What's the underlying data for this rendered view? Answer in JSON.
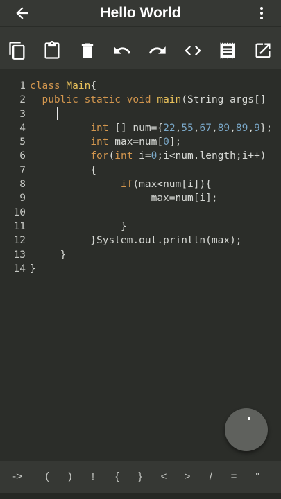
{
  "appbar": {
    "title": "Hello World",
    "back_icon": "arrow-back-icon",
    "menu_icon": "more-vert-icon"
  },
  "toolbar": {
    "tools": [
      "copy-icon",
      "paste-icon",
      "delete-icon",
      "undo-icon",
      "redo-icon",
      "code-icon",
      "receipt-icon",
      "open-external-icon"
    ]
  },
  "editor": {
    "line_numbers": [
      "1",
      "2",
      "3",
      "4",
      "5",
      "6",
      "7",
      "8",
      "9",
      "10",
      "11",
      "12",
      "13",
      "14"
    ],
    "lines": [
      [
        {
          "t": "class",
          "c": "kw"
        },
        {
          "t": " "
        },
        {
          "t": "Main",
          "c": "fn"
        },
        {
          "t": "{"
        }
      ],
      [
        {
          "t": "  "
        },
        {
          "t": "public static void",
          "c": "kw"
        },
        {
          "t": " "
        },
        {
          "t": "main",
          "c": "fn"
        },
        {
          "t": "(String args[]"
        }
      ],
      [],
      [
        {
          "t": "          "
        },
        {
          "t": "int",
          "c": "kw"
        },
        {
          "t": " [] num={"
        },
        {
          "t": "22",
          "c": "num"
        },
        {
          "t": ","
        },
        {
          "t": "55",
          "c": "num"
        },
        {
          "t": ","
        },
        {
          "t": "67",
          "c": "num"
        },
        {
          "t": ","
        },
        {
          "t": "89",
          "c": "num"
        },
        {
          "t": ","
        },
        {
          "t": "89",
          "c": "num"
        },
        {
          "t": ","
        },
        {
          "t": "9",
          "c": "num"
        },
        {
          "t": "};"
        }
      ],
      [
        {
          "t": "          "
        },
        {
          "t": "int",
          "c": "kw"
        },
        {
          "t": " max=num["
        },
        {
          "t": "0",
          "c": "num"
        },
        {
          "t": "];"
        }
      ],
      [
        {
          "t": "          "
        },
        {
          "t": "for",
          "c": "kw"
        },
        {
          "t": "("
        },
        {
          "t": "int",
          "c": "kw"
        },
        {
          "t": " i="
        },
        {
          "t": "0",
          "c": "num"
        },
        {
          "t": ";i<num.length;i++)"
        }
      ],
      [
        {
          "t": "          {"
        }
      ],
      [
        {
          "t": "               "
        },
        {
          "t": "if",
          "c": "kw"
        },
        {
          "t": "(max<num[i]){"
        }
      ],
      [
        {
          "t": "                    max=num[i];"
        }
      ],
      [],
      [
        {
          "t": "               }"
        }
      ],
      [
        {
          "t": "          }System.out.println(max);"
        }
      ],
      [
        {
          "t": "     }"
        }
      ],
      [
        {
          "t": "}"
        }
      ]
    ]
  },
  "symbols": [
    "->",
    "(",
    ")",
    "!",
    "{",
    "}",
    "<",
    ">",
    "/",
    "=",
    "\""
  ],
  "colors": {
    "background": "#2b2d29",
    "bar": "#363834",
    "keyword": "#d2964e",
    "number": "#7aa8c8",
    "method": "#e8c05a",
    "text": "#d6d8d4"
  }
}
